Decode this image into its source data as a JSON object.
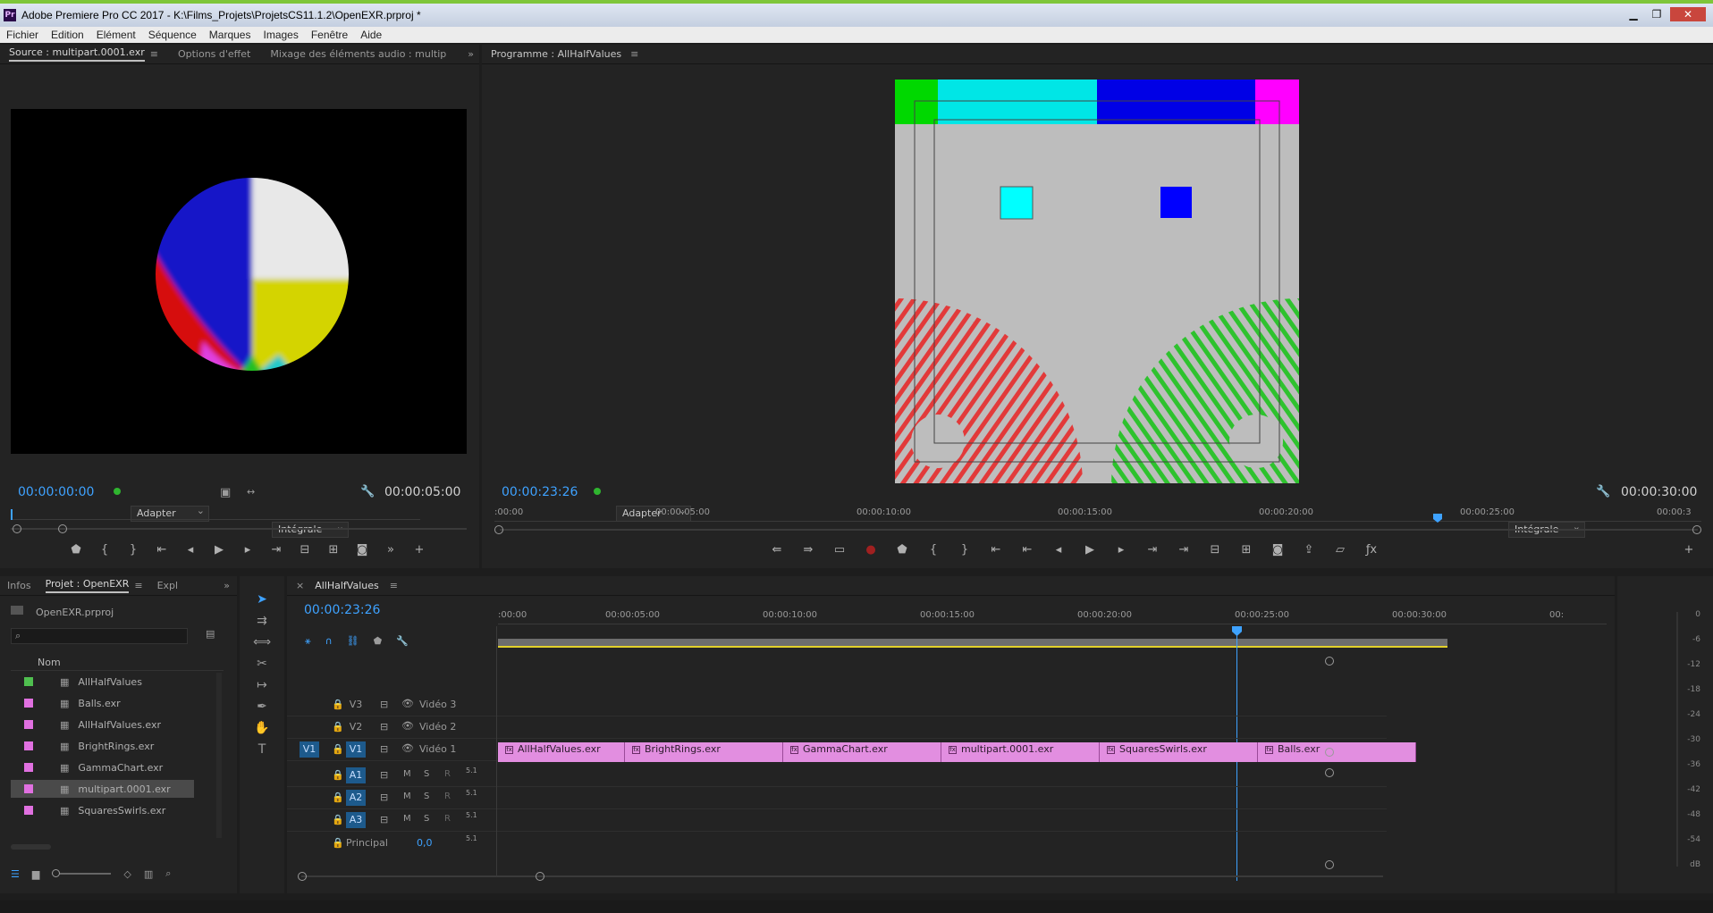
{
  "window": {
    "title": "Adobe Premiere Pro CC 2017 - K:\\Films_Projets\\ProjetsCS11.1.2\\OpenEXR.prproj *",
    "app_icon": "Pr"
  },
  "menu": [
    "Fichier",
    "Edition",
    "Elément",
    "Séquence",
    "Marques",
    "Images",
    "Fenêtre",
    "Aide"
  ],
  "source": {
    "tabs": [
      "Source : multipart.0001.exr",
      "Options d'effet",
      "Mixage des éléments audio : multip"
    ],
    "timecode": "00:00:00:00",
    "fit": "Adapter",
    "quality": "Intégrale",
    "duration": "00:00:05:00"
  },
  "program": {
    "title": "Programme : AllHalfValues",
    "timecode": "00:00:23:26",
    "fit": "Adapter",
    "quality": "Intégrale",
    "duration": "00:00:30:00",
    "ruler": [
      ":00:00",
      "00:00:05:00",
      "00:00:10:00",
      "00:00:15:00",
      "00:00:20:00",
      "00:00:25:00",
      "00:00:3"
    ]
  },
  "project": {
    "tabs": [
      "Infos",
      "Projet : OpenEXR",
      "Expl"
    ],
    "file": "OpenEXR.prproj",
    "column": "Nom",
    "items": [
      {
        "name": "AllHalfValues",
        "color": "#4fbf4f"
      },
      {
        "name": "Balls.exr",
        "color": "#e070e0"
      },
      {
        "name": "AllHalfValues.exr",
        "color": "#e070e0"
      },
      {
        "name": "BrightRings.exr",
        "color": "#e070e0"
      },
      {
        "name": "GammaChart.exr",
        "color": "#e070e0"
      },
      {
        "name": "multipart.0001.exr",
        "color": "#e070e0"
      },
      {
        "name": "SquaresSwirls.exr",
        "color": "#e070e0"
      }
    ]
  },
  "timeline": {
    "seq": "AllHalfValues",
    "timecode": "00:00:23:26",
    "ruler": [
      ":00:00",
      "00:00:05:00",
      "00:00:10:00",
      "00:00:15:00",
      "00:00:20:00",
      "00:00:25:00",
      "00:00:30:00",
      "00:"
    ],
    "video_tracks": [
      {
        "id": "V3",
        "name": "Vidéo 3"
      },
      {
        "id": "V2",
        "name": "Vidéo 2"
      },
      {
        "id": "V1",
        "name": "Vidéo 1"
      }
    ],
    "audio_tracks": [
      "A1",
      "A2",
      "A3"
    ],
    "master": "Principal",
    "master_val": "0,0",
    "clips": [
      "AllHalfValues.exr",
      "BrightRings.exr",
      "GammaChart.exr",
      "multipart.0001.exr",
      "SquaresSwirls.exr",
      "Balls.exr"
    ]
  },
  "meter": [
    "0",
    "-6",
    "-12",
    "-18",
    "-24",
    "-30",
    "-36",
    "-42",
    "-48",
    "-54",
    "dB"
  ]
}
